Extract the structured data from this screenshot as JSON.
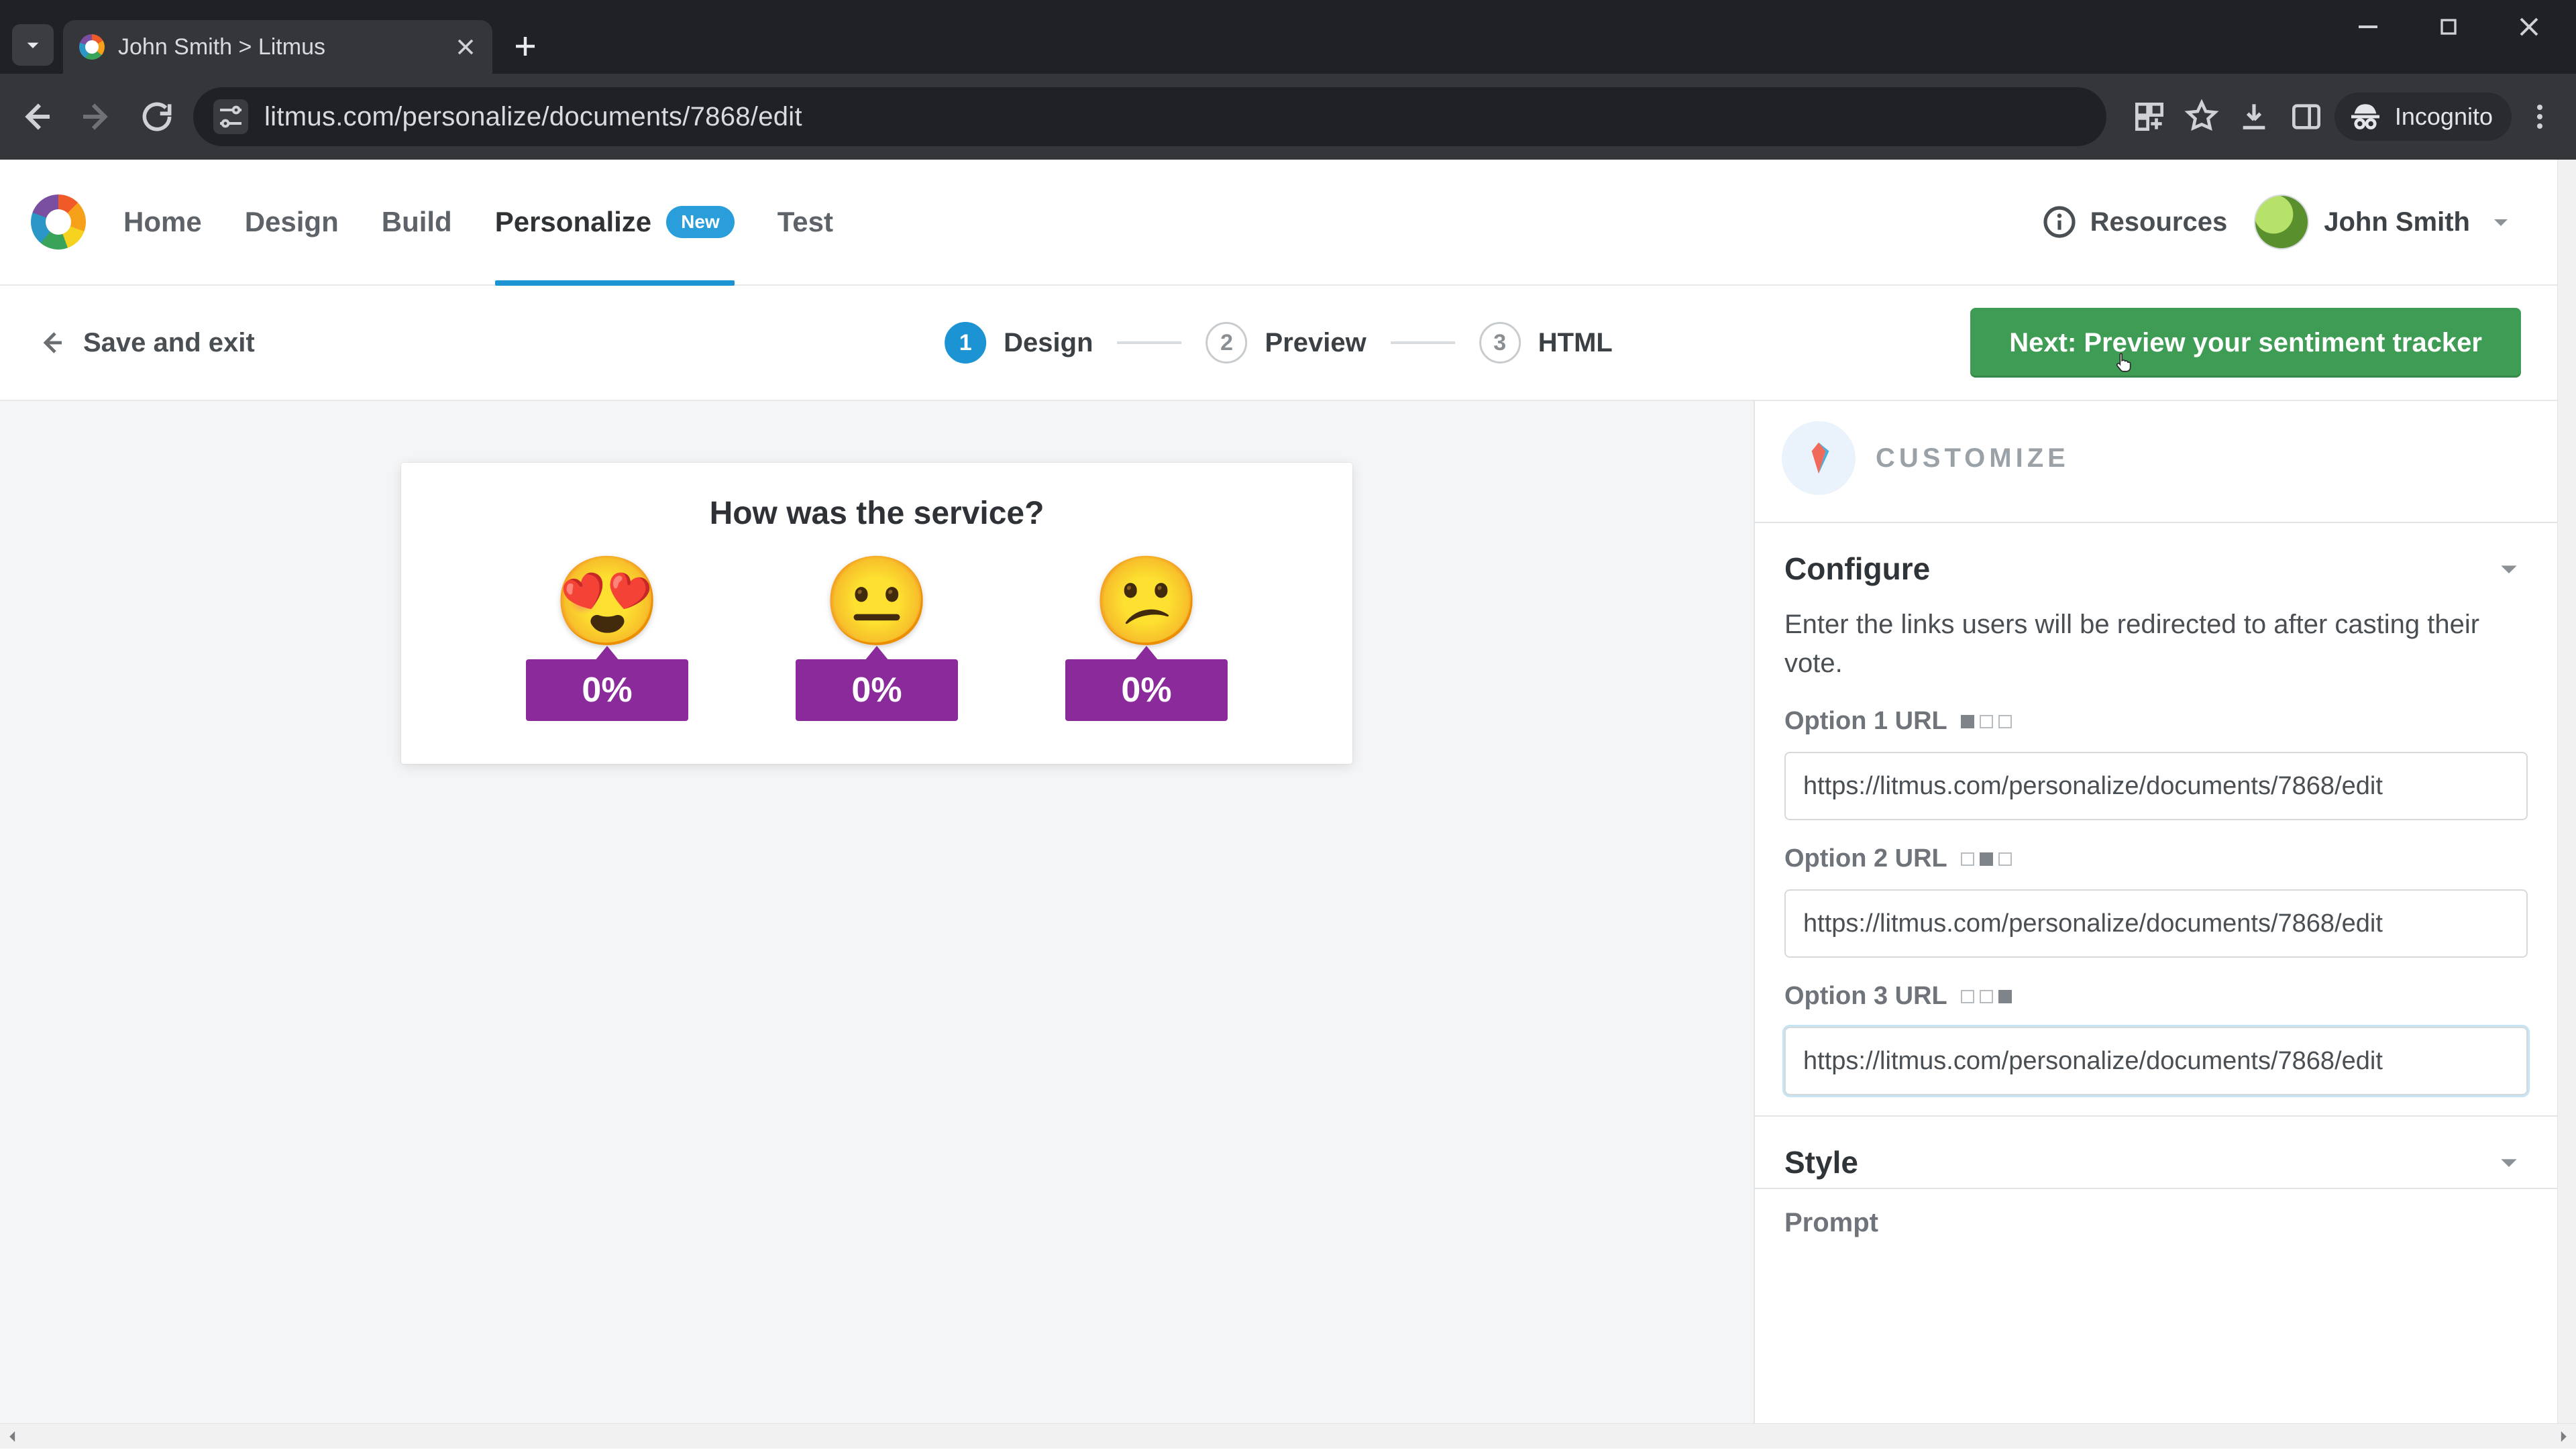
{
  "browser": {
    "tab_title": "John Smith > Litmus",
    "url": "litmus.com/personalize/documents/7868/edit",
    "incognito_label": "Incognito"
  },
  "nav": {
    "links": [
      "Home",
      "Design",
      "Build",
      "Personalize",
      "Test"
    ],
    "active_index": 3,
    "new_badge": "New",
    "resources": "Resources",
    "user_name": "John Smith"
  },
  "stepbar": {
    "save_exit": "Save and exit",
    "steps": [
      {
        "num": "1",
        "label": "Design"
      },
      {
        "num": "2",
        "label": "Preview"
      },
      {
        "num": "3",
        "label": "HTML"
      }
    ],
    "active_step": 0,
    "next_button": "Next: Preview your sentiment tracker"
  },
  "canvas": {
    "title": "How was the service?",
    "options": [
      {
        "emoji": "😍",
        "pct": "0%"
      },
      {
        "emoji": "😐",
        "pct": "0%"
      },
      {
        "emoji": "😕",
        "pct": "0%"
      }
    ]
  },
  "sidebar": {
    "title": "CUSTOMIZE",
    "configure": {
      "title": "Configure",
      "description": "Enter the links users will be redirected to after casting their vote.",
      "fields": [
        {
          "label": "Option 1 URL",
          "value": "https://litmus.com/personalize/documents/7868/edit",
          "fill_index": 0
        },
        {
          "label": "Option 2 URL",
          "value": "https://litmus.com/personalize/documents/7868/edit",
          "fill_index": 1
        },
        {
          "label": "Option 3 URL",
          "value": "https://litmus.com/personalize/documents/7868/edit",
          "fill_index": 2
        }
      ]
    },
    "style": {
      "title": "Style"
    },
    "prompt": {
      "title": "Prompt"
    }
  }
}
